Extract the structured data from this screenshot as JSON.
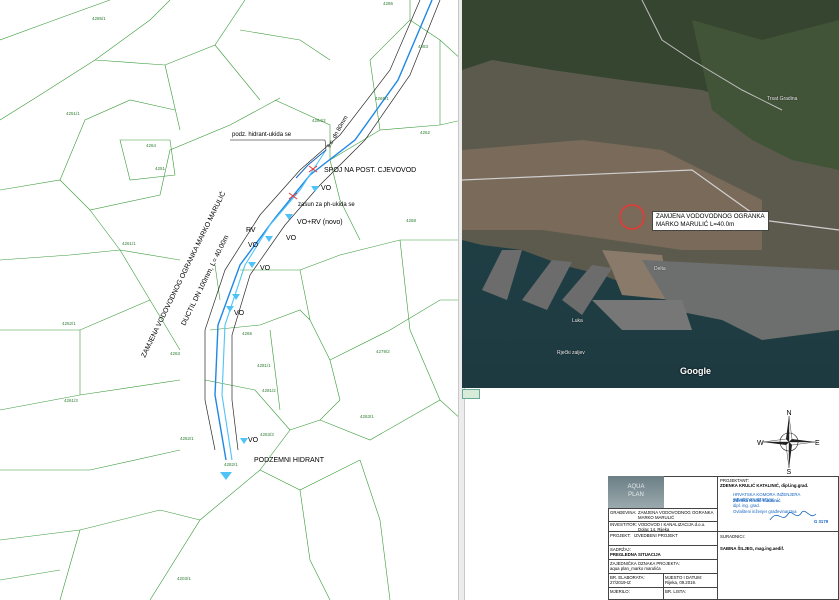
{
  "cad": {
    "parcels": [
      "4285/1",
      "4286",
      "4251/1",
      "4283",
      "4264",
      "4262",
      "4251",
      "4265/1",
      "4264/2",
      "4261/1",
      "4268",
      "4252/1",
      "4263",
      "4279/2",
      "4281/1",
      "4261/3",
      "4281/2",
      "4263/1",
      "4265",
      "4262/1",
      "4263/3",
      "4203/1",
      "4282/1"
    ],
    "annotations": {
      "hydrant_removed": "podz. hidrant-ukida se",
      "pipe_spec": "li.c. dn 80mm",
      "connection": "SPOJ NA POST. CJEVOVOD",
      "valve_removed": "zasun za ph-ukida se",
      "vo_labels": [
        "VO",
        "VO",
        "VO",
        "VO",
        "VO",
        "VO"
      ],
      "vo_rv_new": "VO+RV (novo)",
      "rv": "RV",
      "vertical_title": "ZAMJENA VODOVODNOG OGRANKA MARKO MARULIĆ",
      "vertical_spec": "DUCTIL DN 100mm, L= 40.00m",
      "underground_hydrant": "PODZEMNI HIDRANT"
    }
  },
  "photo": {
    "label_line1": "ZAMJENA VODOVODNOG OGRANKA",
    "label_line2": "MARKO MARULIĆ L=40.0m",
    "places": [
      "Trsat Gradina",
      "Rječki zaljev",
      "Delta",
      "Luka"
    ],
    "google": "Google"
  },
  "compass": {
    "n": "N",
    "s": "S",
    "e": "E",
    "w": "W"
  },
  "title_block": {
    "logo_line1": "AQUA",
    "logo_line2": "PLAN",
    "projektant_label": "PROJEKTANT:",
    "projektant_name": "ZDENKA KRULIĆ KATALINIĆ, dipl.ing.grad.",
    "stamp_line1": "HRVATSKA KOMORA INŽENJERA GRAĐEVINARSTVA",
    "stamp_line2": "Zdenka Krulić Katalinić",
    "stamp_line3": "dipl. ing. grad.",
    "stamp_line4": "Ovlašteni inženjer građevinarstva",
    "stamp_no": "G 3179",
    "gradevina_label": "GRAĐEVINA:",
    "gradevina_value": "ZAMJENA VODOVODNOG OGRANKA MARKO MARULIĆ",
    "investitor_label": "INVESTITOR:",
    "investitor_value": "VODOVOD I KANALIZACIJA d.o.o. Dolac 14, Rijeka",
    "projekt_label": "PROJEKT:",
    "projekt_value": "IZVEDBENI PROJEKT",
    "suradnici_label": "SURADNICI:",
    "suradnici_value": "SABINA ŠILJEG, mag.ing.aedif.",
    "sadrzaj_label": "SADRŽAJ:",
    "sadrzaj_value": "PREGLEDNA SITUACIJA",
    "zajednicka_label": "ZAJEDNIČKA OZNAKA PROJEKTA:",
    "zajednicka_value": "aqua plan_marko marulića",
    "elaborat_label": "BR. ELABORATA:",
    "elaborat_value": "27/2019-IZ",
    "mjesto_label": "MJESTO I DATUM:",
    "mjesto_value": "Rijeka, 09.2019.",
    "mjerilo_label": "MJERILO:",
    "list_label": "BR. LISTA:"
  }
}
